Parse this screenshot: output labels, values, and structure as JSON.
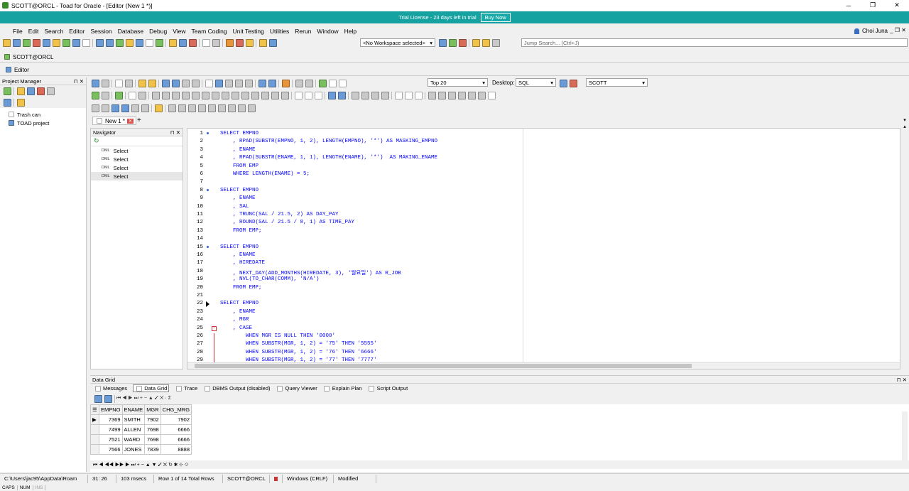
{
  "window": {
    "title": "SCOTT@ORCL - Toad for Oracle - [Editor (New 1 *)]"
  },
  "trial": {
    "text": "Trial License - 23 days left in trial",
    "buy": "Buy Now"
  },
  "menu": [
    "File",
    "Edit",
    "Search",
    "Editor",
    "Session",
    "Database",
    "Debug",
    "View",
    "Team Coding",
    "Unit Testing",
    "Utilities",
    "Rerun",
    "Window",
    "Help"
  ],
  "user": {
    "name": "Choi Juna"
  },
  "toolbar": {
    "workspace": "<No Workspace selected>",
    "jump_search_placeholder": "Jump Search... (Ctrl+J)",
    "top_n": "Top 20",
    "desktop_label": "Desktop:",
    "desktop_value": "SQL",
    "schema": "SCOTT"
  },
  "connection_tab": "SCOTT@ORCL",
  "editor_tab": "Editor",
  "project_manager": {
    "title": "Project Manager",
    "items": [
      "Trash can",
      "TOAD project"
    ]
  },
  "navigator": {
    "title": "Navigator",
    "items": [
      {
        "tag": "DML",
        "label": "Select"
      },
      {
        "tag": "DML",
        "label": "Select"
      },
      {
        "tag": "DML",
        "label": "Select"
      },
      {
        "tag": "DML",
        "label": "Select"
      }
    ]
  },
  "doc_tab": "New 1 *",
  "code_lines": [
    {
      "n": "1",
      "t": "SELECT EMPNO"
    },
    {
      "n": "2",
      "t": "    , RPAD(SUBSTR(EMPNO, 1, 2), LENGTH(EMPNO), '*') AS MASKING_EMPNO"
    },
    {
      "n": "3",
      "t": "    , ENAME"
    },
    {
      "n": "4",
      "t": "    , RPAD(SUBSTR(ENAME, 1, 1), LENGTH(ENAME), '*')  AS MAKING_ENAME"
    },
    {
      "n": "5",
      "t": "    FROM EMP"
    },
    {
      "n": "6",
      "t": "    WHERE LENGTH(ENAME) = 5;"
    },
    {
      "n": "7",
      "t": ""
    },
    {
      "n": "8",
      "t": "SELECT EMPNO"
    },
    {
      "n": "9",
      "t": "    , ENAME"
    },
    {
      "n": "10",
      "t": "    , SAL"
    },
    {
      "n": "11",
      "t": "    , TRUNC(SAL / 21.5, 2) AS DAY_PAY"
    },
    {
      "n": "12",
      "t": "    , ROUND(SAL / 21.5 / 8, 1) AS TIME_PAY"
    },
    {
      "n": "13",
      "t": "    FROM EMP;"
    },
    {
      "n": "14",
      "t": ""
    },
    {
      "n": "15",
      "t": "SELECT EMPNO"
    },
    {
      "n": "16",
      "t": "    , ENAME"
    },
    {
      "n": "17",
      "t": "    , HIREDATE"
    },
    {
      "n": "18",
      "t": "    , NEXT_DAY(ADD_MONTHS(HIREDATE, 3), '월요일') AS R_JOB"
    },
    {
      "n": "19",
      "t": "    , NVL(TO_CHAR(COMM), 'N/A')"
    },
    {
      "n": "20",
      "t": "    FROM EMP;"
    },
    {
      "n": "21",
      "t": ""
    },
    {
      "n": "22",
      "t": "SELECT EMPNO"
    },
    {
      "n": "23",
      "t": "    , ENAME"
    },
    {
      "n": "24",
      "t": "    , MGR"
    },
    {
      "n": "25",
      "t": "    , CASE"
    },
    {
      "n": "26",
      "t": "        WHEN MGR IS NULL THEN '0000'"
    },
    {
      "n": "27",
      "t": "        WHEN SUBSTR(MGR, 1, 2) = '75' THEN '5555'"
    },
    {
      "n": "28",
      "t": "        WHEN SUBSTR(MGR, 1, 2) = '76' THEN '6666'"
    },
    {
      "n": "29",
      "t": "        WHEN SUBSTR(MGR, 1, 2) = '77' THEN '7777'"
    }
  ],
  "data_grid": {
    "title": "Data Grid",
    "tabs": [
      "Messages",
      "Data Grid",
      "Trace",
      "DBMS Output (disabled)",
      "Query Viewer",
      "Explain Plan",
      "Script Output"
    ],
    "columns": [
      "EMPNO",
      "ENAME",
      "MGR",
      "CHG_MRG"
    ],
    "rows": [
      [
        "7369",
        "SMITH",
        "7902",
        "7902"
      ],
      [
        "7499",
        "ALLEN",
        "7698",
        "6666"
      ],
      [
        "7521",
        "WARD",
        "7698",
        "6666"
      ],
      [
        "7566",
        "JONES",
        "7839",
        "8888"
      ]
    ]
  },
  "status": {
    "path": "C:\\Users\\jac95\\AppData\\Roam",
    "pos": "31: 26",
    "time": "103 msecs",
    "rows": "Row 1 of 14 Total Rows",
    "conn": "SCOTT@ORCL",
    "eol": "Windows (CRLF)",
    "modified": "Modified"
  },
  "caps": [
    "CAPS",
    "NUM",
    "INS"
  ]
}
